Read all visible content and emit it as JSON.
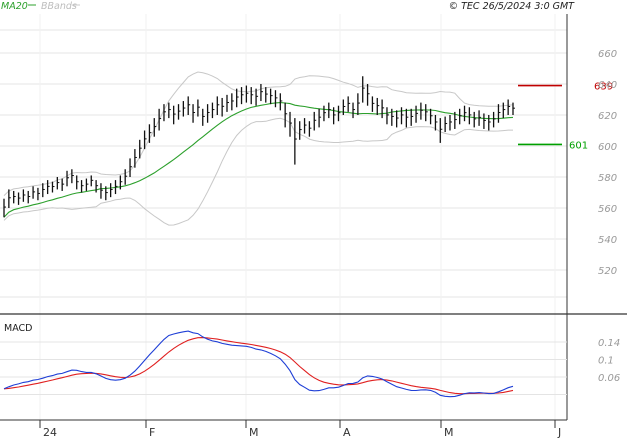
{
  "header": {
    "ma_label": "MA20",
    "bbands_label": "BBands",
    "source_label": "© TEC 26/5/2024 3:0 GMT",
    "ma_color": "#2ca02c",
    "bbands_color": "#c8c8c8"
  },
  "chart_data": [
    {
      "type": "line",
      "panel": "price",
      "x_ticks": [
        "24",
        "F",
        "M",
        "A",
        "M",
        "J"
      ],
      "y_ticks": [
        520,
        540,
        560,
        580,
        600,
        620,
        640,
        660
      ],
      "ylim": [
        500,
        668
      ],
      "grid": true,
      "series": [
        {
          "name": "MA20",
          "color": "#2ca02c",
          "values": []
        },
        {
          "name": "BBands",
          "color": "#c8c8c8",
          "values": []
        }
      ],
      "ohlc_note": "daily high/low bars",
      "bars_hl": [
        [
          554,
          566
        ],
        [
          560,
          572
        ],
        [
          563,
          571
        ],
        [
          562,
          570
        ],
        [
          564,
          572
        ],
        [
          563,
          571
        ],
        [
          566,
          574
        ],
        [
          565,
          573
        ],
        [
          567,
          576
        ],
        [
          569,
          578
        ],
        [
          570,
          577
        ],
        [
          572,
          580
        ],
        [
          571,
          579
        ],
        [
          574,
          584
        ],
        [
          576,
          585
        ],
        [
          572,
          581
        ],
        [
          570,
          578
        ],
        [
          571,
          579
        ],
        [
          574,
          581
        ],
        [
          570,
          578
        ],
        [
          566,
          576
        ],
        [
          565,
          574
        ],
        [
          567,
          576
        ],
        [
          569,
          578
        ],
        [
          572,
          581
        ],
        [
          575,
          585
        ],
        [
          580,
          592
        ],
        [
          586,
          598
        ],
        [
          592,
          604
        ],
        [
          598,
          610
        ],
        [
          602,
          614
        ],
        [
          606,
          618
        ],
        [
          610,
          624
        ],
        [
          616,
          627
        ],
        [
          618,
          628
        ],
        [
          614,
          626
        ],
        [
          617,
          627
        ],
        [
          619,
          629
        ],
        [
          620,
          632
        ],
        [
          615,
          627
        ],
        [
          619,
          630
        ],
        [
          613,
          624
        ],
        [
          615,
          627
        ],
        [
          618,
          628
        ],
        [
          620,
          632
        ],
        [
          619,
          631
        ],
        [
          622,
          633
        ],
        [
          623,
          634
        ],
        [
          625,
          637
        ],
        [
          627,
          638
        ],
        [
          628,
          639
        ],
        [
          627,
          638
        ],
        [
          626,
          637
        ],
        [
          629,
          640
        ],
        [
          628,
          638
        ],
        [
          627,
          637
        ],
        [
          625,
          636
        ],
        [
          623,
          634
        ],
        [
          612,
          628
        ],
        [
          606,
          622
        ],
        [
          588,
          618
        ],
        [
          604,
          616
        ],
        [
          608,
          618
        ],
        [
          606,
          616
        ],
        [
          610,
          622
        ],
        [
          612,
          624
        ],
        [
          616,
          626
        ],
        [
          618,
          628
        ],
        [
          614,
          625
        ],
        [
          616,
          626
        ],
        [
          620,
          630
        ],
        [
          622,
          632
        ],
        [
          618,
          628
        ],
        [
          620,
          634
        ],
        [
          628,
          645
        ],
        [
          626,
          640
        ],
        [
          622,
          632
        ],
        [
          620,
          631
        ],
        [
          618,
          630
        ],
        [
          614,
          625
        ],
        [
          613,
          624
        ],
        [
          612,
          623
        ],
        [
          614,
          625
        ],
        [
          612,
          624
        ],
        [
          613,
          624
        ],
        [
          615,
          626
        ],
        [
          617,
          628
        ],
        [
          616,
          627
        ],
        [
          614,
          624
        ],
        [
          610,
          620
        ],
        [
          602,
          618
        ],
        [
          609,
          619
        ],
        [
          610,
          620
        ],
        [
          611,
          622
        ],
        [
          614,
          624
        ],
        [
          616,
          626
        ],
        [
          614,
          625
        ],
        [
          612,
          622
        ],
        [
          613,
          623
        ],
        [
          611,
          621
        ],
        [
          610,
          620
        ],
        [
          612,
          622
        ],
        [
          615,
          627
        ],
        [
          618,
          628
        ],
        [
          620,
          630
        ],
        [
          620,
          628
        ]
      ]
    },
    {
      "type": "line",
      "panel": "macd",
      "title": "MACD",
      "y_ticks": [
        0.06,
        0.1,
        0.14
      ],
      "series": [
        {
          "name": "MACD",
          "color": "#1f3fd6",
          "values": []
        },
        {
          "name": "Signal",
          "color": "#e02020",
          "values": []
        }
      ]
    }
  ],
  "levels": {
    "resistance": {
      "value": 639,
      "label": "639",
      "color": "#c00000"
    },
    "support": {
      "value": 601,
      "label": "601",
      "color": "#00a000"
    }
  }
}
